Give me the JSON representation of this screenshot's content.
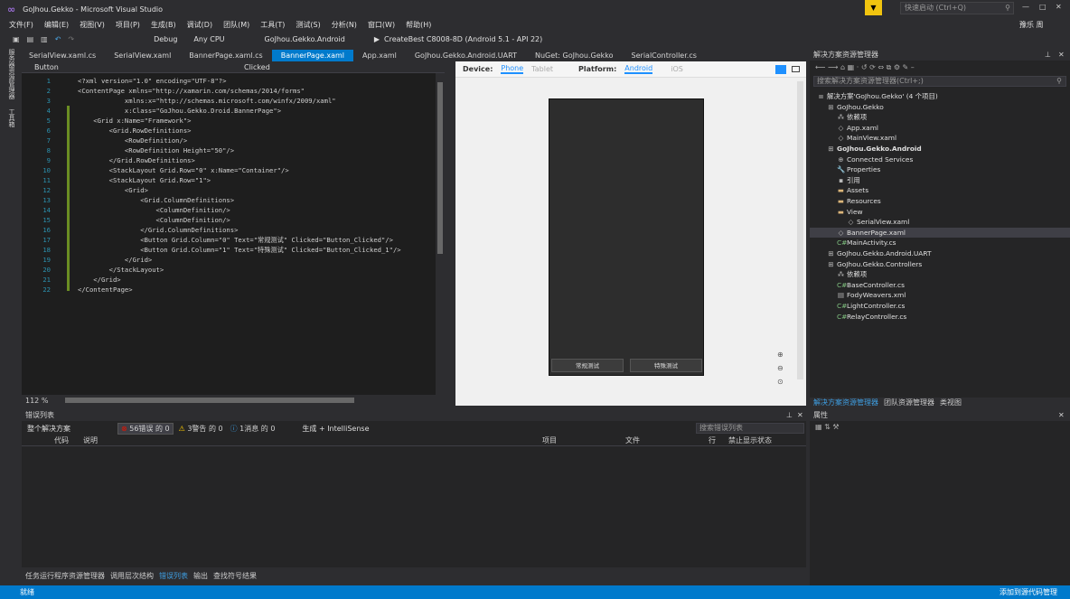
{
  "window": {
    "title": "GoJhou.Gekko - Microsoft Visual Studio",
    "quick_launch_placeholder": "快速启动 (Ctrl+Q)",
    "user": "豫乐 周"
  },
  "menu": [
    "文件(F)",
    "编辑(E)",
    "视图(V)",
    "项目(P)",
    "生成(B)",
    "调试(D)",
    "团队(M)",
    "工具(T)",
    "测试(S)",
    "分析(N)",
    "窗口(W)",
    "帮助(H)"
  ],
  "toolbar": {
    "config": "Debug",
    "platform": "Any CPU",
    "startup": "GoJhou.Gekko.Android",
    "run_target": "CreateBest C8008-8D (Android 5.1 - API 22)"
  },
  "left_strip": [
    "服务器资源管理器",
    "工具箱"
  ],
  "tabs": [
    {
      "label": "SerialView.xaml.cs",
      "active": false
    },
    {
      "label": "SerialView.xaml",
      "active": false
    },
    {
      "label": "BannerPage.xaml.cs",
      "active": false
    },
    {
      "label": "BannerPage.xaml",
      "active": true
    },
    {
      "label": "App.xaml",
      "active": false
    },
    {
      "label": "GoJhou.Gekko.Android.UART",
      "active": false
    },
    {
      "label": "NuGet: GoJhou.Gekko",
      "active": false
    },
    {
      "label": "SerialController.cs",
      "active": false
    }
  ],
  "nav": {
    "left": "Button",
    "right": "Clicked"
  },
  "code": [
    "<?xml version=\"1.0\" encoding=\"UTF-8\"?>",
    "<ContentPage xmlns=\"http://xamarin.com/schemas/2014/forms\"",
    "            xmlns:x=\"http://schemas.microsoft.com/winfx/2009/xaml\"",
    "            x:Class=\"GoJhou.Gekko.Droid.BannerPage\">",
    "    <Grid x:Name=\"Framework\">",
    "        <Grid.RowDefinitions>",
    "            <RowDefinition/>",
    "            <RowDefinition Height=\"50\"/>",
    "        </Grid.RowDefinitions>",
    "        <StackLayout Grid.Row=\"0\" x:Name=\"Container\"/>",
    "        <StackLayout Grid.Row=\"1\">",
    "            <Grid>",
    "                <Grid.ColumnDefinitions>",
    "                    <ColumnDefinition/>",
    "                    <ColumnDefinition/>",
    "                </Grid.ColumnDefinitions>",
    "                <Button Grid.Column=\"0\" Text=\"常规测试\" Clicked=\"Button_Clicked\"/>",
    "                <Button Grid.Column=\"1\" Text=\"特殊测试\" Clicked=\"Button_Clicked_1\"/>",
    "            </Grid>",
    "        </StackLayout>",
    "    </Grid>",
    "</ContentPage>"
  ],
  "zoom": "112 %",
  "preview": {
    "device_label": "Device:",
    "device_opts": [
      "Phone",
      "Tablet"
    ],
    "platform_label": "Platform:",
    "platform_opts": [
      "Android",
      "iOS"
    ],
    "buttons": [
      "常规测试",
      "特殊测试"
    ]
  },
  "solution_explorer": {
    "title": "解决方案资源管理器",
    "search_placeholder": "搜索解决方案资源管理器(Ctrl+;)",
    "items": [
      {
        "label": "解决方案'GoJhou.Gekko' (4 个项目)",
        "indent": 0,
        "icon": "solution-icon",
        "bold": false,
        "sel": false
      },
      {
        "label": "GoJhou.Gekko",
        "indent": 1,
        "icon": "csproj-icon",
        "bold": false,
        "sel": false
      },
      {
        "label": "依赖项",
        "indent": 2,
        "icon": "dependencies-icon",
        "bold": false,
        "sel": false
      },
      {
        "label": "App.xaml",
        "indent": 2,
        "icon": "xaml-icon",
        "bold": false,
        "sel": false
      },
      {
        "label": "MainView.xaml",
        "indent": 2,
        "icon": "xaml-icon",
        "bold": false,
        "sel": false
      },
      {
        "label": "GoJhou.Gekko.Android",
        "indent": 1,
        "icon": "android-project-icon",
        "bold": true,
        "sel": false
      },
      {
        "label": "Connected Services",
        "indent": 2,
        "icon": "connected-services-icon",
        "bold": false,
        "sel": false
      },
      {
        "label": "Properties",
        "indent": 2,
        "icon": "wrench-icon",
        "bold": false,
        "sel": false
      },
      {
        "label": "引用",
        "indent": 2,
        "icon": "references-icon",
        "bold": false,
        "sel": false
      },
      {
        "label": "Assets",
        "indent": 2,
        "icon": "folder-icon",
        "bold": false,
        "sel": false
      },
      {
        "label": "Resources",
        "indent": 2,
        "icon": "folder-icon",
        "bold": false,
        "sel": false
      },
      {
        "label": "View",
        "indent": 2,
        "icon": "folder-icon",
        "bold": false,
        "sel": false
      },
      {
        "label": "SerialView.xaml",
        "indent": 3,
        "icon": "xaml-icon",
        "bold": false,
        "sel": false
      },
      {
        "label": "BannerPage.xaml",
        "indent": 2,
        "icon": "xaml-icon",
        "bold": false,
        "sel": true
      },
      {
        "label": "MainActivity.cs",
        "indent": 2,
        "icon": "csharp-icon",
        "bold": false,
        "sel": false
      },
      {
        "label": "GoJhou.Gekko.Android.UART",
        "indent": 1,
        "icon": "csproj-icon",
        "bold": false,
        "sel": false
      },
      {
        "label": "GoJhou.Gekko.Controllers",
        "indent": 1,
        "icon": "csproj-icon",
        "bold": false,
        "sel": false
      },
      {
        "label": "依赖项",
        "indent": 2,
        "icon": "dependencies-icon",
        "bold": false,
        "sel": false
      },
      {
        "label": "BaseController.cs",
        "indent": 2,
        "icon": "csharp-icon",
        "bold": false,
        "sel": false
      },
      {
        "label": "FodyWeavers.xml",
        "indent": 2,
        "icon": "xml-icon",
        "bold": false,
        "sel": false
      },
      {
        "label": "LightController.cs",
        "indent": 2,
        "icon": "csharp-icon",
        "bold": false,
        "sel": false
      },
      {
        "label": "RelayController.cs",
        "indent": 2,
        "icon": "csharp-icon",
        "bold": false,
        "sel": false
      }
    ],
    "bottom_tabs": [
      "解决方案资源管理器",
      "团队资源管理器",
      "类视图"
    ]
  },
  "error_list": {
    "title": "错误列表",
    "scope": "整个解决方案",
    "errors": "56错误 的 0",
    "warnings": "3警告 的 0",
    "messages": "1消息 的 0",
    "build_filter": "生成 + IntelliSense",
    "search_placeholder": "搜索错误列表",
    "columns": [
      "代码",
      "说明",
      "项目",
      "文件",
      "行",
      "禁止显示状态"
    ]
  },
  "properties": {
    "title": "属性"
  },
  "bottom_tabs": [
    "任务运行程序资源管理器",
    "调用层次结构",
    "错误列表",
    "输出",
    "查找符号结果"
  ],
  "status": {
    "left": "就绪",
    "right": "添加到源代码管理"
  }
}
